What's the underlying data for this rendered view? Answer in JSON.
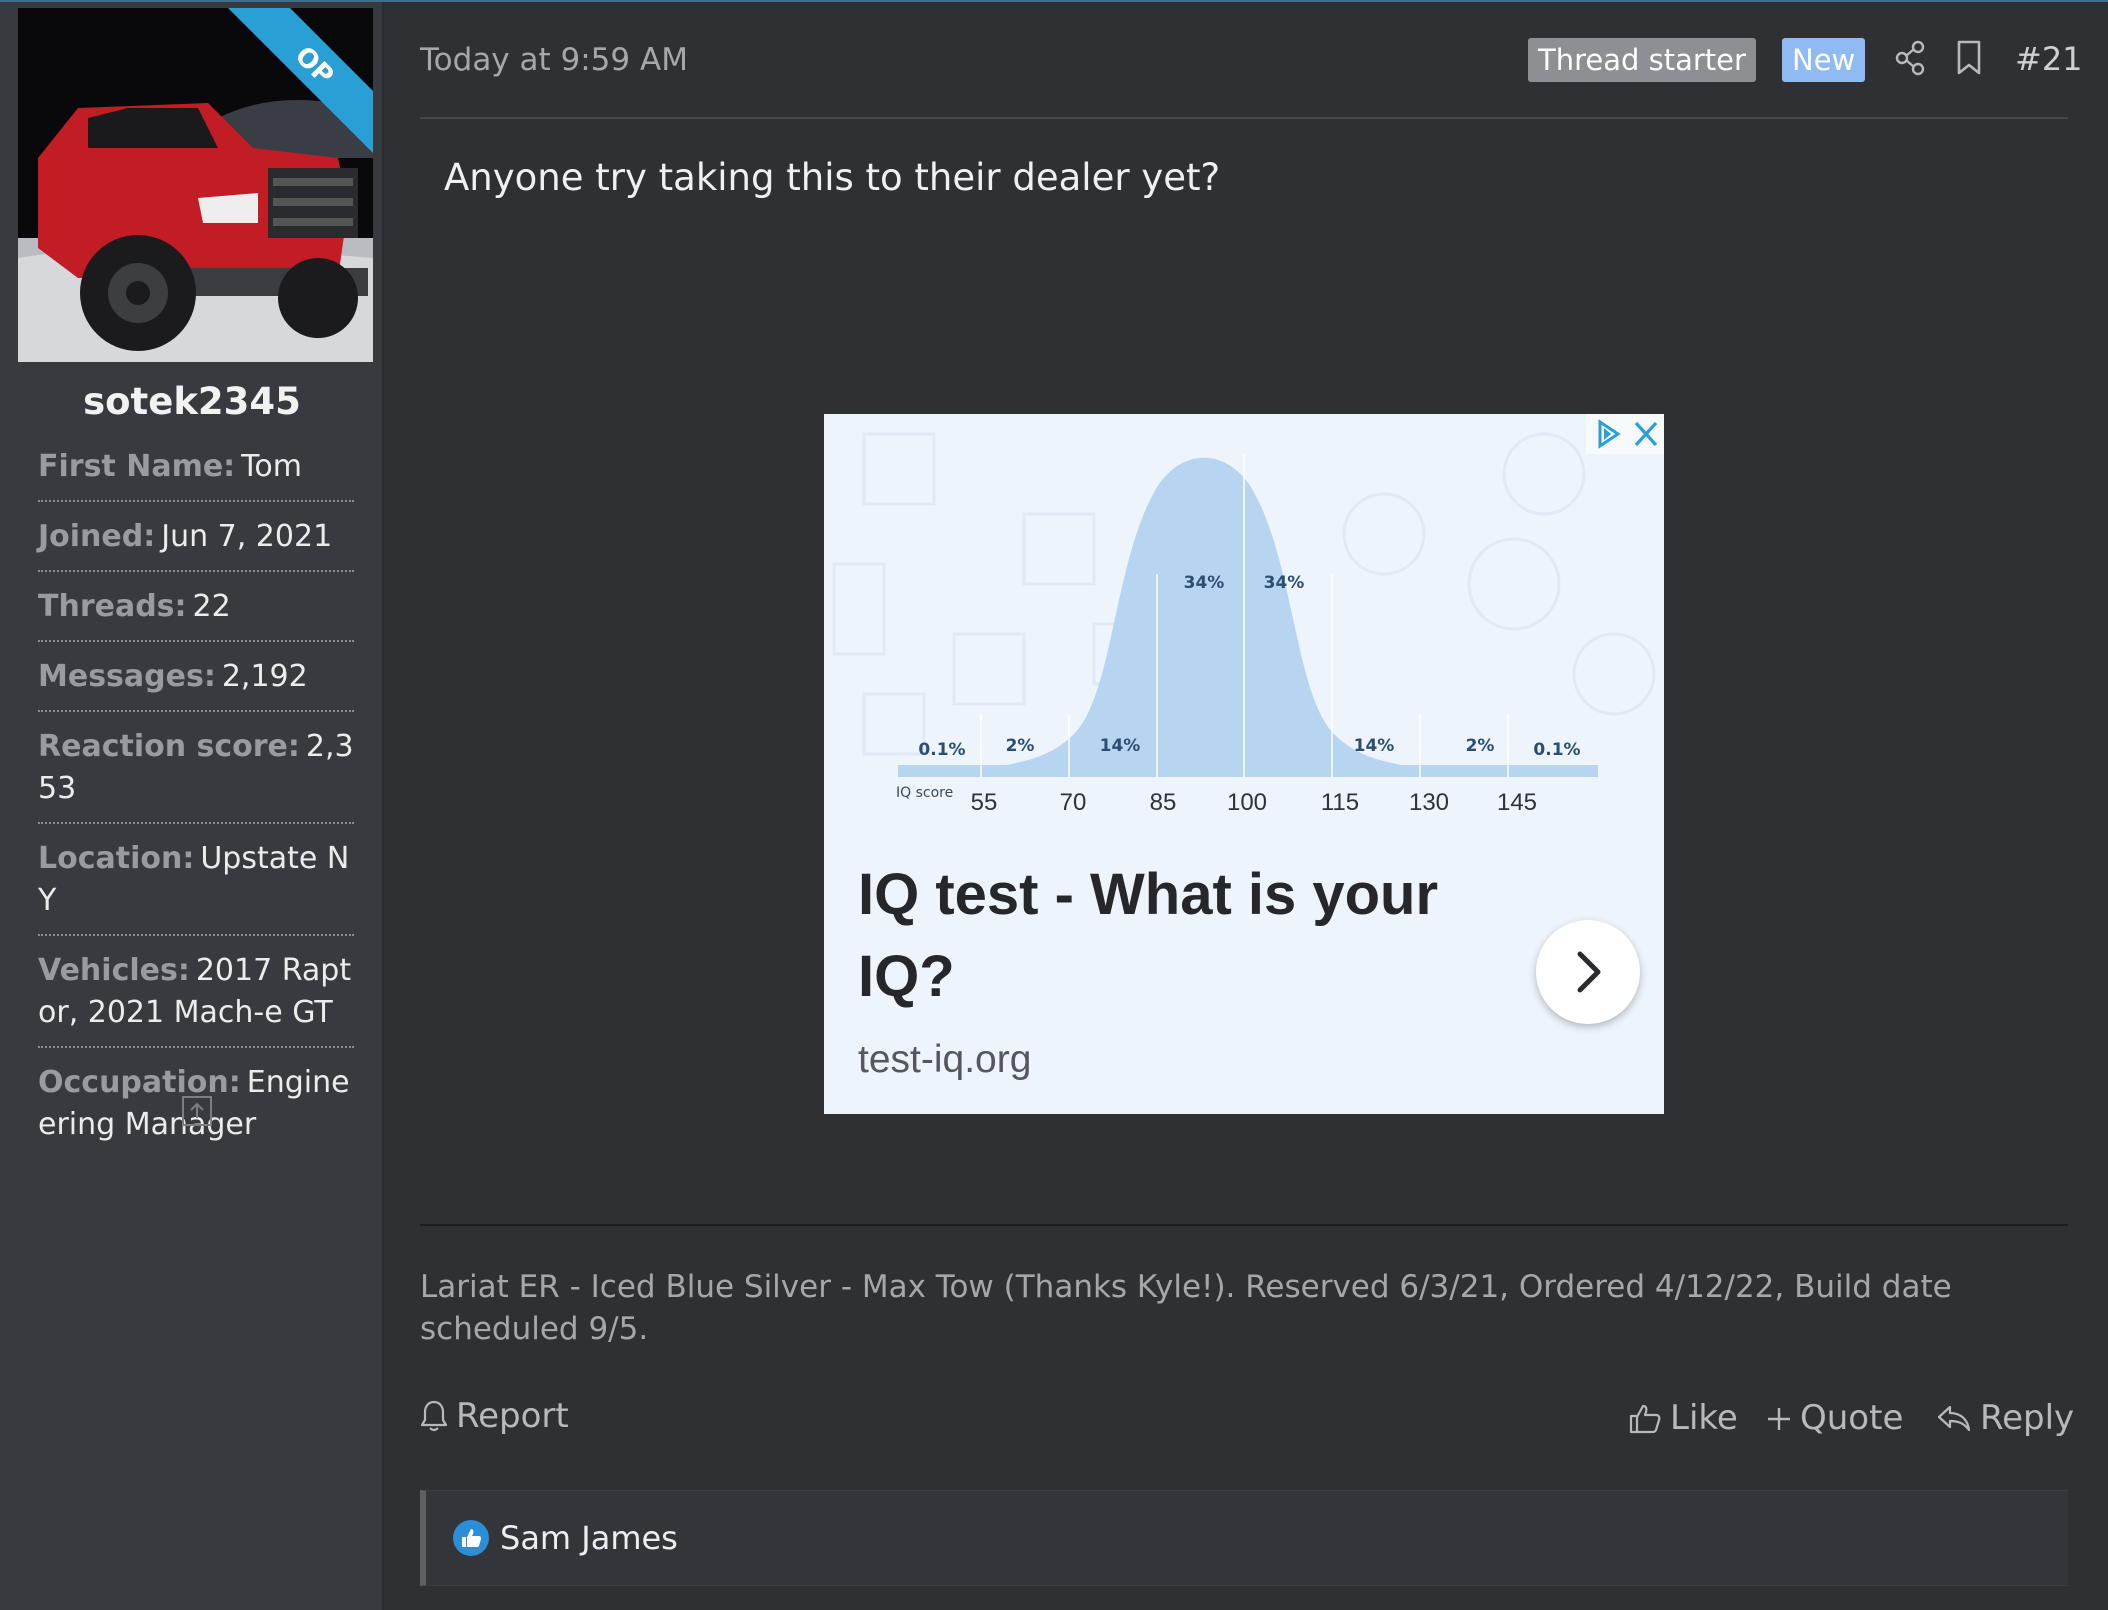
{
  "user": {
    "username": "sotek2345",
    "op_ribbon": "OP",
    "fields": [
      {
        "label": "First Name:",
        "value": "Tom"
      },
      {
        "label": "Joined:",
        "value": "Jun 7, 2021"
      },
      {
        "label": "Threads:",
        "value": "22"
      },
      {
        "label": "Messages:",
        "value": "2,192"
      },
      {
        "label": "Reaction score:",
        "value": "2,353"
      },
      {
        "label": "Location:",
        "value": "Upstate NY"
      },
      {
        "label": "Vehicles:",
        "value": "2017 Raptor, 2021 Mach-e GT"
      },
      {
        "label": "Occupation:",
        "value": "Engineering Manager"
      }
    ]
  },
  "header": {
    "date": "Today at 9:59 AM",
    "badge_starter": "Thread starter",
    "badge_new": "New",
    "post_number": "#21",
    "icons": [
      "share-icon",
      "bookmark-icon"
    ]
  },
  "post": {
    "message": "Anyone try taking this to their dealer yet?",
    "signature": "Lariat ER - Iced Blue Silver - Max Tow (Thanks Kyle!). Reserved 6/3/21, Ordered 4/12/22, Build date scheduled 9/5."
  },
  "ad": {
    "title": "IQ test - What is your IQ?",
    "domain": "test-iq.org",
    "chart": {
      "axis_label": "IQ score",
      "ticks": [
        "55",
        "70",
        "85",
        "100",
        "115",
        "130",
        "145"
      ],
      "percentages": [
        "0.1%",
        "2%",
        "14%",
        "34%",
        "34%",
        "14%",
        "2%",
        "0.1%"
      ]
    }
  },
  "actions": {
    "report": "Report",
    "like": "Like",
    "quote": "Quote",
    "reply": "Reply"
  },
  "reactions": {
    "names": "Sam James"
  },
  "colors": {
    "badge_new": "#8fbaf2",
    "badge_starter": "#8d8f94",
    "op_ribbon": "#2a9fd6",
    "like_reaction": "#2b8fd8"
  }
}
